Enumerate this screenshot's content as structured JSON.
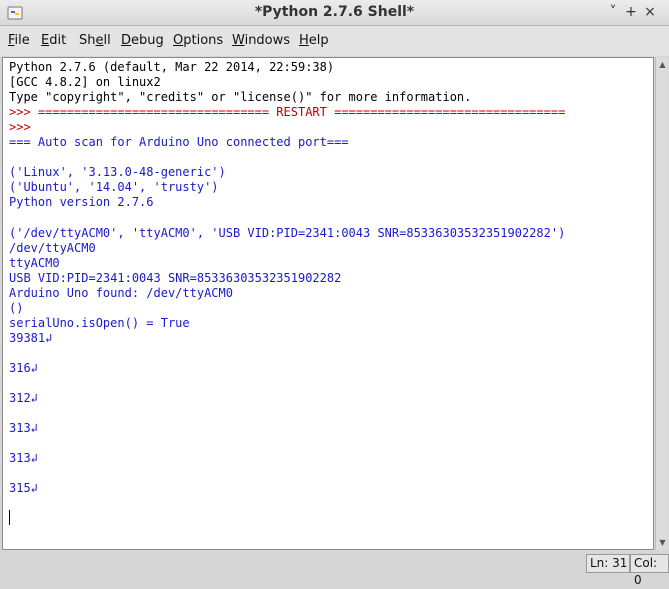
{
  "window": {
    "title": "*Python 2.7.6 Shell*",
    "controls": {
      "minimize": "˅",
      "maximize": "+",
      "close": "×"
    }
  },
  "menu": {
    "items": [
      {
        "pre": "",
        "u": "F",
        "post": "ile"
      },
      {
        "pre": "",
        "u": "E",
        "post": "dit"
      },
      {
        "pre": "Sh",
        "u": "e",
        "post": "ll"
      },
      {
        "pre": "",
        "u": "D",
        "post": "ebug"
      },
      {
        "pre": "",
        "u": "O",
        "post": "ptions"
      },
      {
        "pre": "",
        "u": "W",
        "post": "indows"
      },
      {
        "pre": "",
        "u": "H",
        "post": "elp"
      }
    ]
  },
  "shell": {
    "lines": [
      {
        "text": "Python 2.7.6 (default, Mar 22 2014, 22:59:38)",
        "style": "black"
      },
      {
        "text": "[GCC 4.8.2] on linux2",
        "style": "black"
      },
      {
        "text": "Type \"copyright\", \"credits\" or \"license()\" for more information.",
        "style": "black"
      },
      {
        "text": ">>> ================================ RESTART ================================",
        "style": "red"
      },
      {
        "text": ">>>",
        "style": "red"
      },
      {
        "text": "=== Auto scan for Arduino Uno connected port===",
        "style": "out"
      },
      {
        "text": "",
        "style": "out"
      },
      {
        "text": "('Linux', '3.13.0-48-generic')",
        "style": "out"
      },
      {
        "text": "('Ubuntu', '14.04', 'trusty')",
        "style": "out"
      },
      {
        "text": "Python version 2.7.6",
        "style": "out"
      },
      {
        "text": "",
        "style": "out"
      },
      {
        "text": "('/dev/ttyACM0', 'ttyACM0', 'USB VID:PID=2341:0043 SNR=85336303532351902282')",
        "style": "out"
      },
      {
        "text": "/dev/ttyACM0",
        "style": "out"
      },
      {
        "text": "ttyACM0",
        "style": "out"
      },
      {
        "text": "USB VID:PID=2341:0043 SNR=85336303532351902282",
        "style": "out"
      },
      {
        "text": "Arduino Uno found: /dev/ttyACM0",
        "style": "out"
      },
      {
        "text": "()",
        "style": "out"
      },
      {
        "text": "serialUno.isOpen() = True",
        "style": "out"
      },
      {
        "text": "39381↲",
        "style": "out"
      },
      {
        "text": "",
        "style": "out"
      },
      {
        "text": "316↲",
        "style": "out"
      },
      {
        "text": "",
        "style": "out"
      },
      {
        "text": "312↲",
        "style": "out"
      },
      {
        "text": "",
        "style": "out"
      },
      {
        "text": "313↲",
        "style": "out"
      },
      {
        "text": "",
        "style": "out"
      },
      {
        "text": "313↲",
        "style": "out"
      },
      {
        "text": "",
        "style": "out"
      },
      {
        "text": "315↲",
        "style": "out"
      },
      {
        "text": "",
        "style": "out"
      }
    ],
    "colors": {
      "prompt": "#c00000",
      "output": "#1a1ac8",
      "banner": "#000000"
    }
  },
  "status": {
    "line": "Ln: 31",
    "col": "Col: 0"
  },
  "icons": {
    "app": "python-idle-icon"
  }
}
